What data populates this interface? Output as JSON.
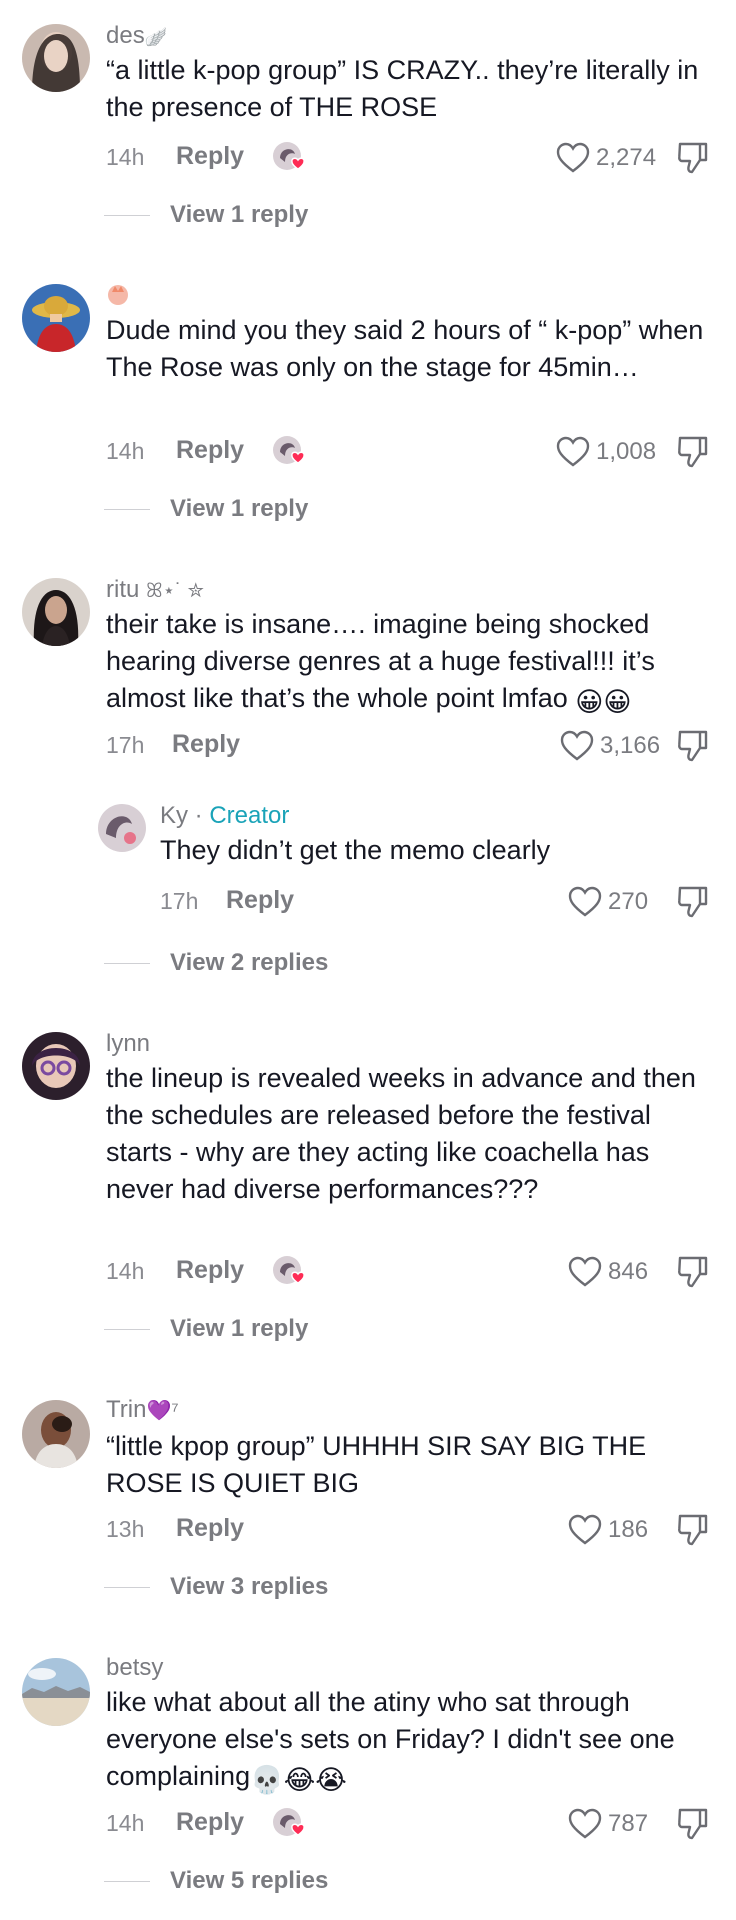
{
  "comments": [
    {
      "username": "des",
      "username_suffix": "🪽",
      "text": "“a little k-pop group” IS CRAZY.. they’re literally in the presence of THE ROSE",
      "time": "14h",
      "reply_label": "Reply",
      "likes": "2,274",
      "view_replies": "View 1 reply",
      "creator_liked": true
    },
    {
      "username": "",
      "text": "Dude mind you they said 2 hours of “ k-pop” when The Rose was only on the stage for 45min…",
      "time": "14h",
      "reply_label": "Reply",
      "likes": "1,008",
      "view_replies": "View 1 reply",
      "creator_liked": true
    },
    {
      "username": "ritu",
      "username_suffix": "ꕤ⋆˙ ✮",
      "text": "their take is insane…. imagine being shocked hearing diverse genres at a huge festival!!! it’s almost like that’s the whole point lmfao",
      "emoji": "😀😀",
      "time": "17h",
      "reply_label": "Reply",
      "likes": "3,166",
      "creator_liked": false
    },
    {
      "is_reply": true,
      "username": "Ky",
      "separator": " · ",
      "badge": "Creator",
      "text": "They didn’t get the memo clearly",
      "time": "17h",
      "reply_label": "Reply",
      "likes": "270",
      "view_replies": "View 2 replies",
      "creator_liked": false
    },
    {
      "username": "lynn",
      "text": "the lineup is revealed weeks in advance and then the schedules are released before the festival starts - why are they acting like coachella has never had diverse performances???",
      "time": "14h",
      "reply_label": "Reply",
      "likes": "846",
      "view_replies": "View 1 reply",
      "creator_liked": true
    },
    {
      "username": "Trin",
      "username_suffix": "💜⁷",
      "text": "“little kpop group” UHHHH SIR SAY BIG THE ROSE IS QUIET BIG",
      "time": "13h",
      "reply_label": "Reply",
      "likes": "186",
      "view_replies": "View 3 replies",
      "creator_liked": false
    },
    {
      "username": "betsy",
      "text": "like what about all the atiny who sat through everyone else's sets on Friday? I didn't see one complaining",
      "emoji": "💀😂😭",
      "time": "14h",
      "reply_label": "Reply",
      "likes": "787",
      "view_replies": "View 5 replies",
      "creator_liked": true
    }
  ],
  "colors": {
    "text": "#161823",
    "muted": "#7a7b80",
    "creator_badge": "#1aa3b8",
    "creator_heart": "#fe2c55"
  },
  "icons": [
    "heart-outline-icon",
    "thumbs-down-icon",
    "creator-liked-avatar-icon"
  ]
}
